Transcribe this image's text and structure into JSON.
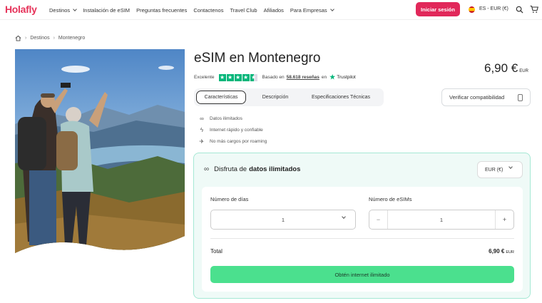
{
  "nav": {
    "logo": "Holafly",
    "links": [
      "Destinos",
      "Instalación de eSIM",
      "Preguntas frecuentes",
      "Contactenos",
      "Travel Club",
      "Afiliados",
      "Para Empresas"
    ],
    "login_label": "Iniciar sesión",
    "lang": "ES - EUR (€)",
    "brand_color": "#e1285a"
  },
  "breadcrumb": {
    "items": [
      "Destinos",
      "Montenegro"
    ]
  },
  "product": {
    "title": "eSIM en Montenegro",
    "price": "6,90 €",
    "price_unit": "EUR",
    "rating_label": "Excelente",
    "rating_stars": 4.5,
    "reviews_prefix": "Basado en",
    "reviews_count": "58.618 reseñas",
    "reviews_suffix": "en",
    "trustpilot": "Trustpilot"
  },
  "tabs": [
    "Características",
    "Descripción",
    "Especificaciones Técnicas"
  ],
  "verify_label": "Verificar compatibilidad",
  "features": [
    {
      "icon": "infinity-icon",
      "text": "Datos ilimitados"
    },
    {
      "icon": "lightning-icon",
      "text": "Internet rápido y confiable"
    },
    {
      "icon": "no-roaming-icon",
      "text": "No más cargos por roaming"
    }
  ],
  "panel": {
    "heading_prefix": "Disfruta de",
    "heading_bold": "datos ilimitados",
    "currency": "EUR (€)",
    "days_label": "Número de días",
    "days_value": "1",
    "esims_label": "Número de eSIMs",
    "esims_value": "1",
    "minus": "−",
    "plus": "+",
    "total_label": "Total",
    "total_value": "6,90 €",
    "total_unit": "EUR",
    "cta_label": "Obtén internet ilimitado",
    "cta_color": "#4be08e"
  }
}
